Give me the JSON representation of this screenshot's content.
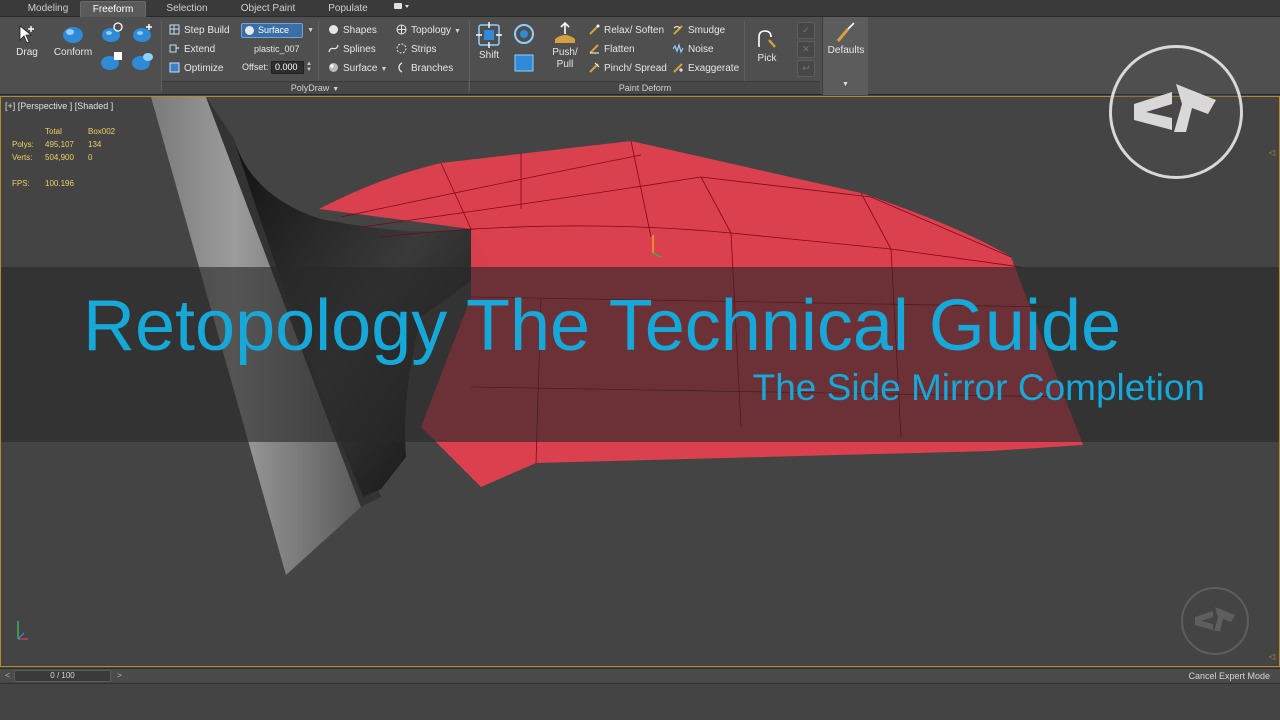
{
  "tabs": [
    "Modeling",
    "Freeform",
    "Selection",
    "Object Paint",
    "Populate"
  ],
  "active_tab": "Freeform",
  "ribbon": {
    "drag": "Drag",
    "conform": "Conform",
    "step_build": "Step Build",
    "extend": "Extend",
    "optimize": "Optimize",
    "surface_dropdown": "Surface",
    "surface_object": "plastic_007",
    "offset_label": "Offset:",
    "offset_value": "0.000",
    "shapes": "Shapes",
    "splines": "Splines",
    "surface": "Surface",
    "topology": "Topology",
    "strips": "Strips",
    "branches": "Branches",
    "shift": "Shift",
    "push_pull": "Push/ Pull",
    "relax_soften": "Relax/ Soften",
    "flatten": "Flatten",
    "pinch_spread": "Pinch/ Spread",
    "smudge": "Smudge",
    "noise": "Noise",
    "exaggerate": "Exaggerate",
    "pick": "Pick",
    "defaults": "Defaults",
    "group_polydraw": "PolyDraw",
    "group_paint_deform": "Paint Deform"
  },
  "viewport": {
    "label": "[+] [Perspective ] [Shaded ]",
    "stats": {
      "header_total": "Total",
      "header_object": "Box002",
      "polys_label": "Polys:",
      "polys_total": "495,107",
      "polys_object": "134",
      "verts_label": "Verts:",
      "verts_total": "504,900",
      "verts_object": "0",
      "fps_label": "FPS:",
      "fps_value": "100.196"
    }
  },
  "overlay": {
    "title": "Retopology The Technical Guide",
    "subtitle": "The Side Mirror Completion",
    "title_color": "#16a8d8"
  },
  "timeline": {
    "frame": "0 / 100",
    "cancel_expert": "Cancel Expert Mode"
  },
  "colors": {
    "retopo_mesh": "#e8404f",
    "viewport_border": "#b48a2a",
    "ribbon_bg": "#4f4f4f"
  }
}
